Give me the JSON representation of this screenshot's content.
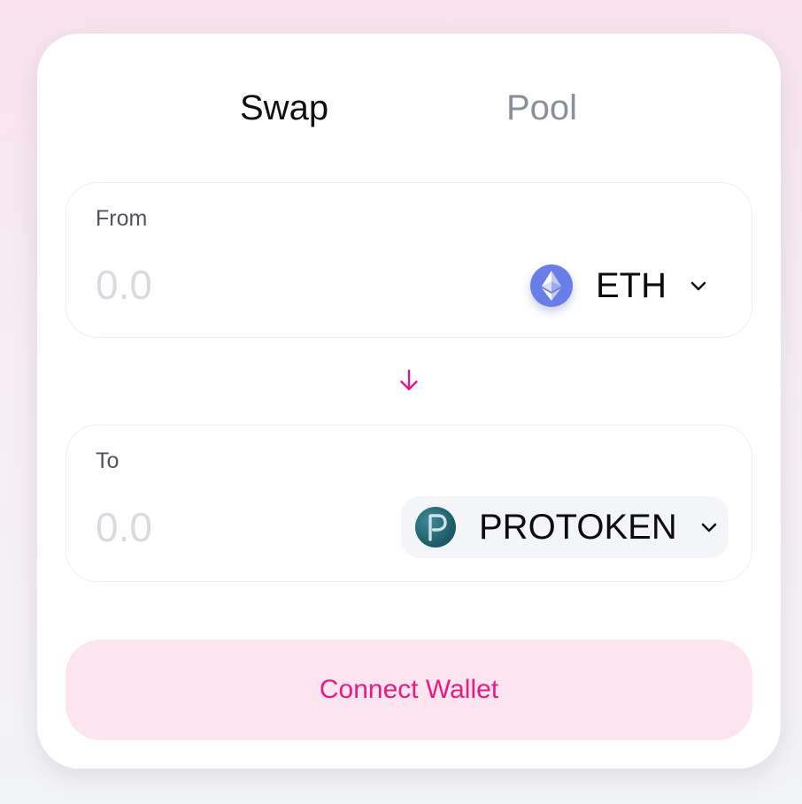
{
  "tabs": {
    "swap_label": "Swap",
    "pool_label": "Pool",
    "active": "Swap"
  },
  "from": {
    "label": "From",
    "amount_placeholder": "0.0",
    "amount_value": "",
    "token": {
      "symbol": "ETH",
      "icon": "ethereum-icon"
    }
  },
  "swap_direction_icon": "arrow-down-icon",
  "to": {
    "label": "To",
    "amount_placeholder": "0.0",
    "amount_value": "",
    "token": {
      "symbol": "PROTOKEN",
      "icon": "protoken-logo-icon"
    }
  },
  "connect_button": {
    "label": "Connect Wallet"
  },
  "colors": {
    "accent": "#ea1a82",
    "accent_bg": "#fce5ee",
    "eth_icon": "#6a7ee8",
    "protoken_icon": "#1f5f6b",
    "inactive_tab": "#8b8f99",
    "placeholder": "#d9dbe1"
  }
}
